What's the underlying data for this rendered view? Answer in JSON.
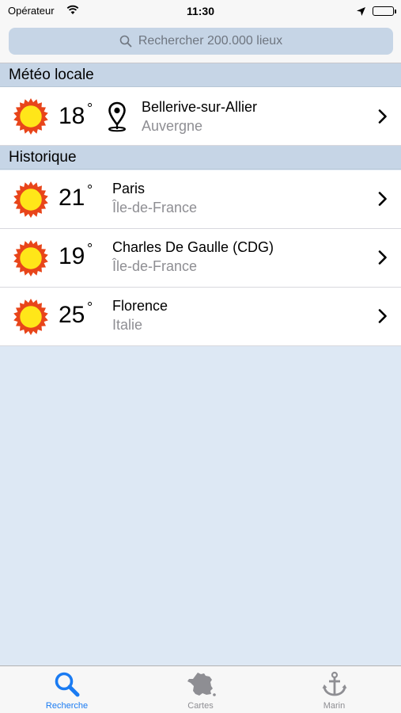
{
  "status_bar": {
    "carrier": "Opérateur",
    "time": "11:30"
  },
  "search": {
    "placeholder": "Rechercher 200.000 lieux"
  },
  "sections": {
    "local": {
      "title": "Météo locale"
    },
    "history": {
      "title": "Historique"
    }
  },
  "local_weather": {
    "temperature": "18",
    "degree": "°",
    "name": "Bellerive-sur-Allier",
    "region": "Auvergne",
    "icon": "sun-icon"
  },
  "history": [
    {
      "temperature": "21",
      "degree": "°",
      "name": "Paris",
      "region": "Île-de-France",
      "icon": "sun-icon"
    },
    {
      "temperature": "19",
      "degree": "°",
      "name": "Charles De Gaulle (CDG)",
      "region": "Île-de-France",
      "icon": "sun-icon"
    },
    {
      "temperature": "25",
      "degree": "°",
      "name": "Florence",
      "region": "Italie",
      "icon": "sun-icon"
    }
  ],
  "tabs": [
    {
      "label": "Recherche",
      "icon": "magnifier-icon",
      "active": true
    },
    {
      "label": "Cartes",
      "icon": "france-map-icon",
      "active": false
    },
    {
      "label": "Marin",
      "icon": "anchor-icon",
      "active": false
    }
  ],
  "colors": {
    "accent": "#1a7bf2",
    "section_background": "#c6d5e6",
    "page_background": "#dde8f4",
    "sun_fill": "#ffe619",
    "sun_outline": "#e8451a"
  }
}
